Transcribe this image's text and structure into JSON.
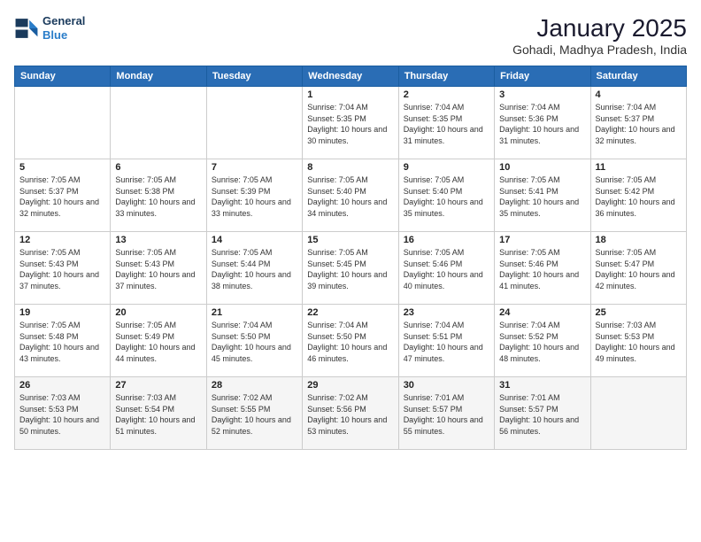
{
  "logo": {
    "line1": "General",
    "line2": "Blue"
  },
  "header": {
    "title": "January 2025",
    "subtitle": "Gohadi, Madhya Pradesh, India"
  },
  "days_of_week": [
    "Sunday",
    "Monday",
    "Tuesday",
    "Wednesday",
    "Thursday",
    "Friday",
    "Saturday"
  ],
  "weeks": [
    [
      {
        "day": "",
        "info": ""
      },
      {
        "day": "",
        "info": ""
      },
      {
        "day": "",
        "info": ""
      },
      {
        "day": "1",
        "info": "Sunrise: 7:04 AM\nSunset: 5:35 PM\nDaylight: 10 hours\nand 30 minutes."
      },
      {
        "day": "2",
        "info": "Sunrise: 7:04 AM\nSunset: 5:35 PM\nDaylight: 10 hours\nand 31 minutes."
      },
      {
        "day": "3",
        "info": "Sunrise: 7:04 AM\nSunset: 5:36 PM\nDaylight: 10 hours\nand 31 minutes."
      },
      {
        "day": "4",
        "info": "Sunrise: 7:04 AM\nSunset: 5:37 PM\nDaylight: 10 hours\nand 32 minutes."
      }
    ],
    [
      {
        "day": "5",
        "info": "Sunrise: 7:05 AM\nSunset: 5:37 PM\nDaylight: 10 hours\nand 32 minutes."
      },
      {
        "day": "6",
        "info": "Sunrise: 7:05 AM\nSunset: 5:38 PM\nDaylight: 10 hours\nand 33 minutes."
      },
      {
        "day": "7",
        "info": "Sunrise: 7:05 AM\nSunset: 5:39 PM\nDaylight: 10 hours\nand 33 minutes."
      },
      {
        "day": "8",
        "info": "Sunrise: 7:05 AM\nSunset: 5:40 PM\nDaylight: 10 hours\nand 34 minutes."
      },
      {
        "day": "9",
        "info": "Sunrise: 7:05 AM\nSunset: 5:40 PM\nDaylight: 10 hours\nand 35 minutes."
      },
      {
        "day": "10",
        "info": "Sunrise: 7:05 AM\nSunset: 5:41 PM\nDaylight: 10 hours\nand 35 minutes."
      },
      {
        "day": "11",
        "info": "Sunrise: 7:05 AM\nSunset: 5:42 PM\nDaylight: 10 hours\nand 36 minutes."
      }
    ],
    [
      {
        "day": "12",
        "info": "Sunrise: 7:05 AM\nSunset: 5:43 PM\nDaylight: 10 hours\nand 37 minutes."
      },
      {
        "day": "13",
        "info": "Sunrise: 7:05 AM\nSunset: 5:43 PM\nDaylight: 10 hours\nand 37 minutes."
      },
      {
        "day": "14",
        "info": "Sunrise: 7:05 AM\nSunset: 5:44 PM\nDaylight: 10 hours\nand 38 minutes."
      },
      {
        "day": "15",
        "info": "Sunrise: 7:05 AM\nSunset: 5:45 PM\nDaylight: 10 hours\nand 39 minutes."
      },
      {
        "day": "16",
        "info": "Sunrise: 7:05 AM\nSunset: 5:46 PM\nDaylight: 10 hours\nand 40 minutes."
      },
      {
        "day": "17",
        "info": "Sunrise: 7:05 AM\nSunset: 5:46 PM\nDaylight: 10 hours\nand 41 minutes."
      },
      {
        "day": "18",
        "info": "Sunrise: 7:05 AM\nSunset: 5:47 PM\nDaylight: 10 hours\nand 42 minutes."
      }
    ],
    [
      {
        "day": "19",
        "info": "Sunrise: 7:05 AM\nSunset: 5:48 PM\nDaylight: 10 hours\nand 43 minutes."
      },
      {
        "day": "20",
        "info": "Sunrise: 7:05 AM\nSunset: 5:49 PM\nDaylight: 10 hours\nand 44 minutes."
      },
      {
        "day": "21",
        "info": "Sunrise: 7:04 AM\nSunset: 5:50 PM\nDaylight: 10 hours\nand 45 minutes."
      },
      {
        "day": "22",
        "info": "Sunrise: 7:04 AM\nSunset: 5:50 PM\nDaylight: 10 hours\nand 46 minutes."
      },
      {
        "day": "23",
        "info": "Sunrise: 7:04 AM\nSunset: 5:51 PM\nDaylight: 10 hours\nand 47 minutes."
      },
      {
        "day": "24",
        "info": "Sunrise: 7:04 AM\nSunset: 5:52 PM\nDaylight: 10 hours\nand 48 minutes."
      },
      {
        "day": "25",
        "info": "Sunrise: 7:03 AM\nSunset: 5:53 PM\nDaylight: 10 hours\nand 49 minutes."
      }
    ],
    [
      {
        "day": "26",
        "info": "Sunrise: 7:03 AM\nSunset: 5:53 PM\nDaylight: 10 hours\nand 50 minutes."
      },
      {
        "day": "27",
        "info": "Sunrise: 7:03 AM\nSunset: 5:54 PM\nDaylight: 10 hours\nand 51 minutes."
      },
      {
        "day": "28",
        "info": "Sunrise: 7:02 AM\nSunset: 5:55 PM\nDaylight: 10 hours\nand 52 minutes."
      },
      {
        "day": "29",
        "info": "Sunrise: 7:02 AM\nSunset: 5:56 PM\nDaylight: 10 hours\nand 53 minutes."
      },
      {
        "day": "30",
        "info": "Sunrise: 7:01 AM\nSunset: 5:57 PM\nDaylight: 10 hours\nand 55 minutes."
      },
      {
        "day": "31",
        "info": "Sunrise: 7:01 AM\nSunset: 5:57 PM\nDaylight: 10 hours\nand 56 minutes."
      },
      {
        "day": "",
        "info": ""
      }
    ]
  ]
}
